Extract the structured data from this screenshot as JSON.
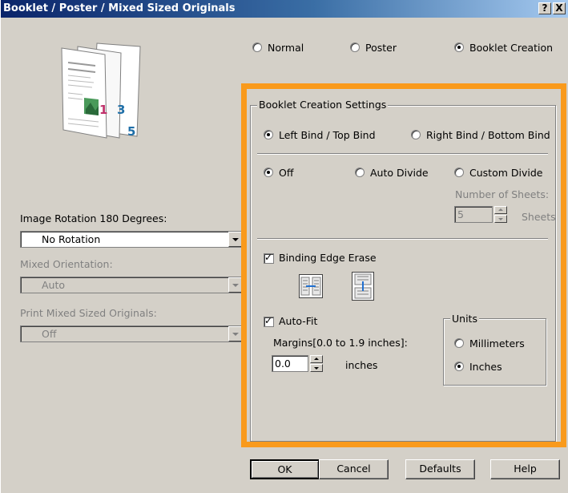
{
  "title": "Booklet / Poster / Mixed Sized Originals",
  "title_buttons": {
    "help": "?",
    "close": "X"
  },
  "mode": {
    "options": [
      "Normal",
      "Poster",
      "Booklet Creation"
    ],
    "selected": "Booklet Creation"
  },
  "illustration": {
    "page_numbers": [
      "1",
      "3",
      "5"
    ]
  },
  "left": {
    "image_rotation_label": "Image Rotation 180 Degrees:",
    "image_rotation_value": "No Rotation",
    "mixed_orientation_label": "Mixed Orientation:",
    "mixed_orientation_value": "Auto",
    "print_mixed_label": "Print Mixed Sized Originals:",
    "print_mixed_value": "Off"
  },
  "booklet": {
    "group_label": "Booklet Creation Settings",
    "bind_options": [
      "Left Bind / Top Bind",
      "Right Bind / Bottom Bind"
    ],
    "bind_selected": "Left Bind / Top Bind",
    "divide_options": [
      "Off",
      "Auto Divide",
      "Custom Divide"
    ],
    "divide_selected": "Off",
    "sheets_label": "Number of Sheets:",
    "sheets_value": "5",
    "sheets_unit": "Sheets",
    "binding_edge_erase_label": "Binding Edge Erase",
    "binding_edge_erase_checked": true,
    "auto_fit_label": "Auto-Fit",
    "auto_fit_checked": true,
    "margins_label": "Margins[0.0 to 1.9 inches]:",
    "margins_value": "0.0",
    "margins_unit": "inches",
    "units_label": "Units",
    "units_options": [
      "Millimeters",
      "Inches"
    ],
    "units_selected": "Inches"
  },
  "buttons": {
    "ok": "OK",
    "cancel": "Cancel",
    "defaults": "Defaults",
    "help": "Help"
  },
  "colors": {
    "highlight": "#f99a1c",
    "titlebar": "#0a246a",
    "face": "#d4d0c8"
  }
}
